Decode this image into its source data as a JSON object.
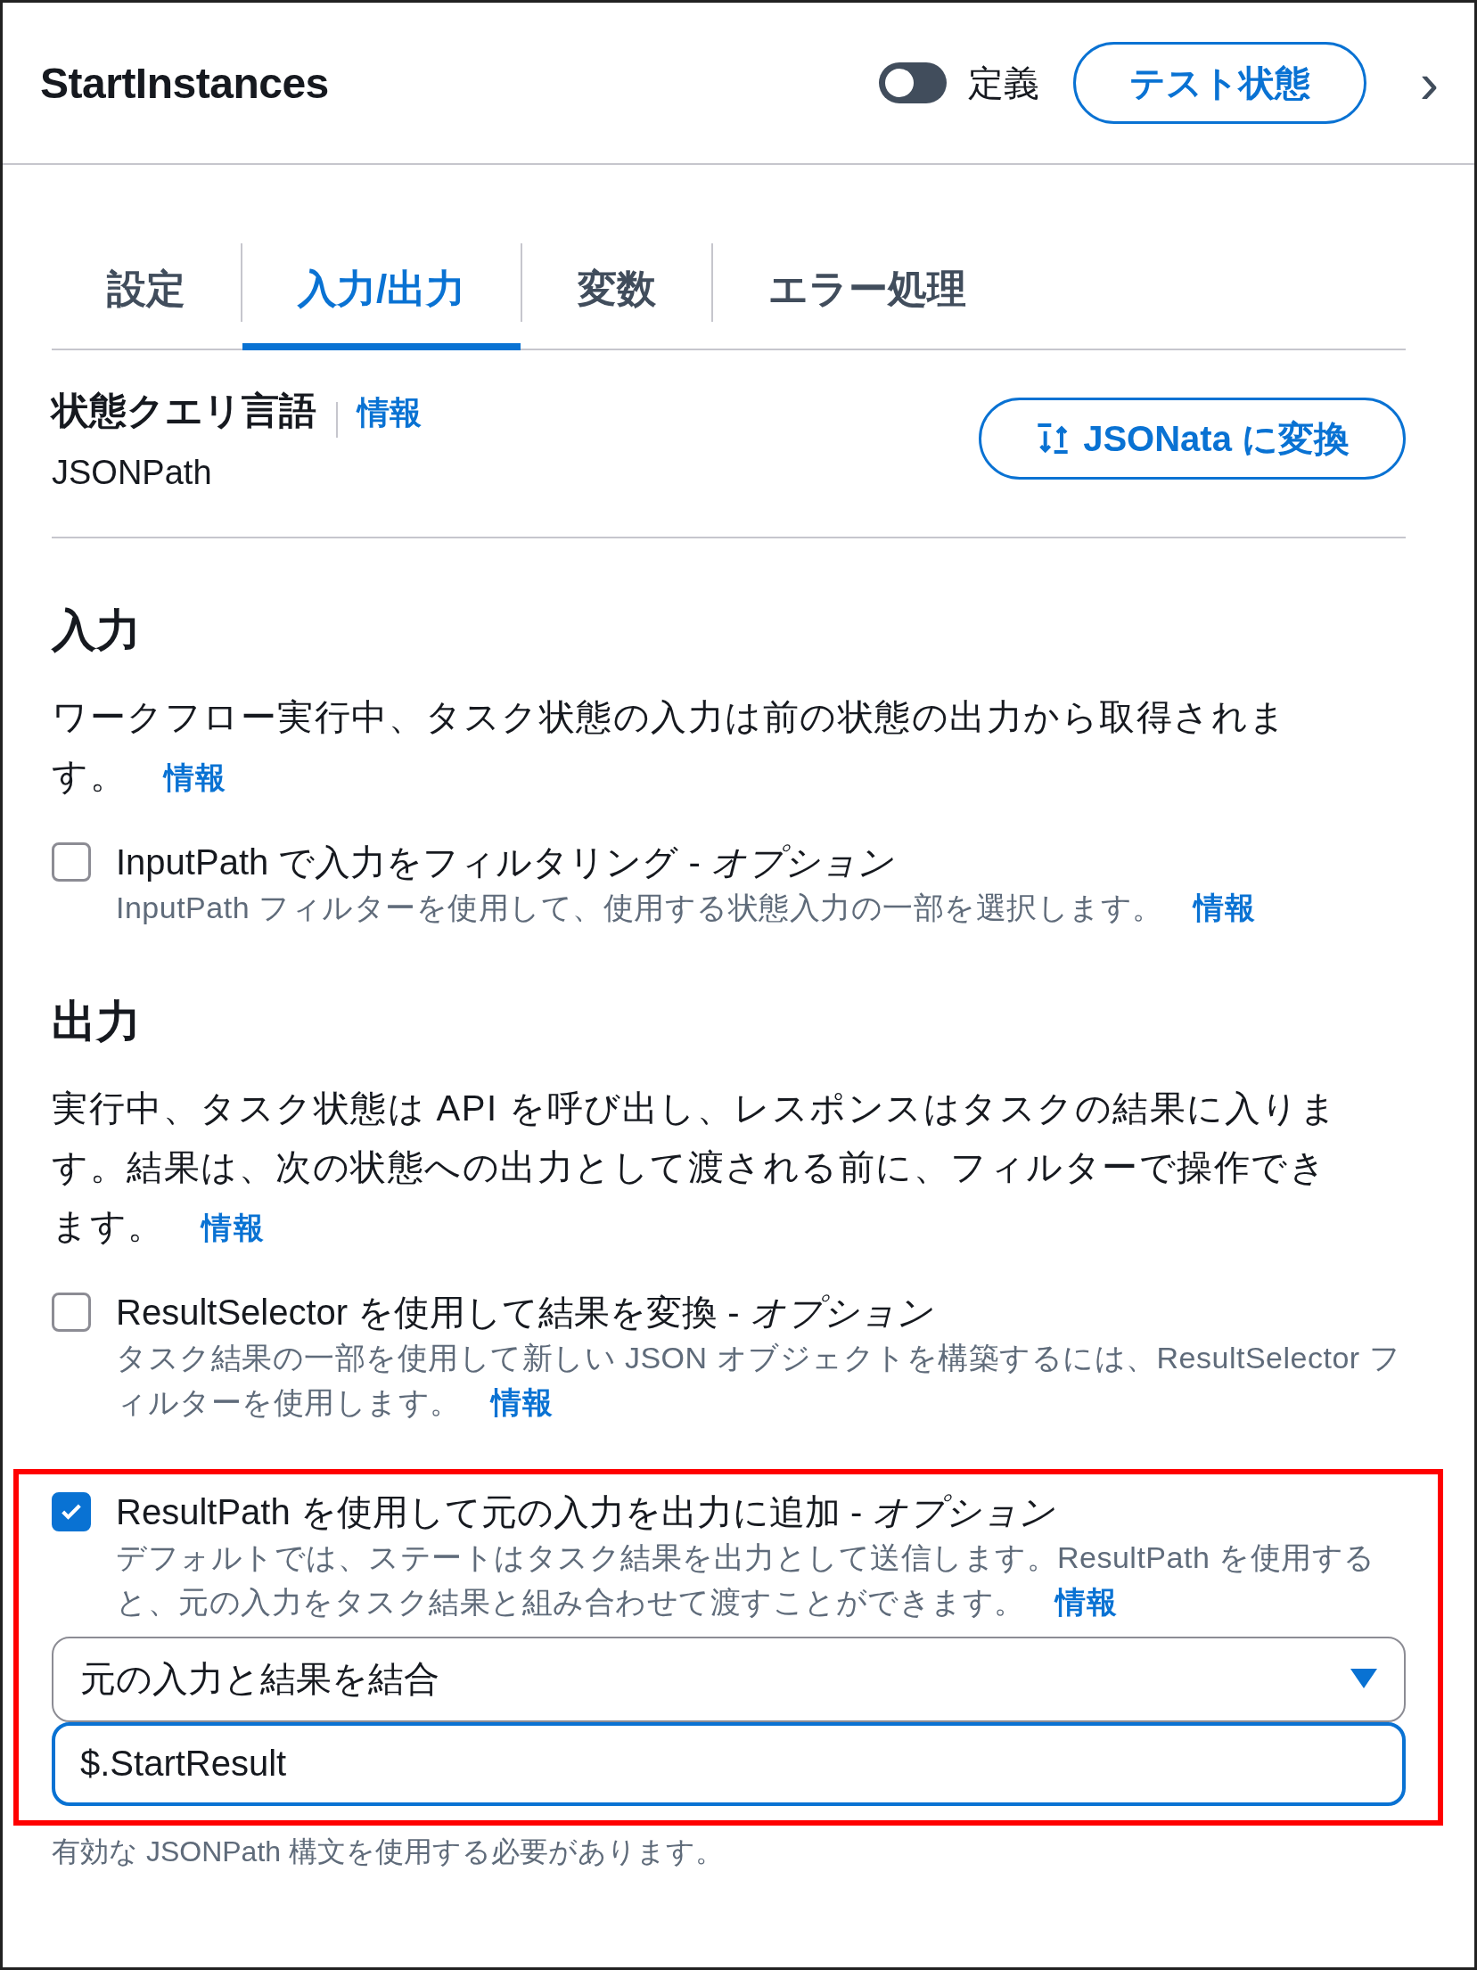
{
  "header": {
    "title": "StartInstances",
    "definition_toggle": {
      "label": "定義",
      "on": false
    },
    "test_button": "テスト状態",
    "chevron": "›"
  },
  "tabs": [
    {
      "label": "設定",
      "selected": false
    },
    {
      "label": "入力/出力",
      "selected": true
    },
    {
      "label": "変数",
      "selected": false
    },
    {
      "label": "エラー処理",
      "selected": false
    }
  ],
  "query_language": {
    "label": "状態クエリ言語",
    "info": "情報",
    "value": "JSONPath",
    "convert_button": "JSONata に変換"
  },
  "sections": [
    {
      "heading": "入力",
      "text": "ワークフロー実行中、タスク状態の入力は前の状態の出力から取得されます。",
      "info": "情報",
      "options": [
        {
          "label": "InputPath で入力をフィルタリング -  *オプション*",
          "description": "InputPath フィルターを使用して、使用する状態入力の一部を選択します。",
          "info": "情報",
          "checked": false,
          "highlighted": false
        }
      ]
    },
    {
      "heading": "出力",
      "text": "実行中、タスク状態は API を呼び出し、レスポンスはタスクの結果に入ります。結果は、次の状態への出力として渡される前に、フィルターで操作できます。",
      "info": "情報",
      "options": [
        {
          "label": "ResultSelector を使用して結果を変換 - *オプション*",
          "description": "タスク結果の一部を使用して新しい JSON オブジェクトを構築するには、ResultSelector フィルターを使用します。",
          "info": "情報",
          "checked": false,
          "highlighted": false
        },
        {
          "label": "ResultPath を使用して元の入力を出力に追加 - *オプション*",
          "description": "デフォルトでは、ステートはタスク結果を出力として送信します。ResultPath を使用すると、元の入力をタスク結果と組み合わせて渡すことができます。",
          "info": "情報",
          "checked": true,
          "highlighted": true,
          "select": {
            "value": "元の入力と結果を結合"
          },
          "input": {
            "value": "$.StartResult"
          },
          "hint": "有効な JSONPath 構文を使用する必要があります。"
        }
      ]
    }
  ]
}
